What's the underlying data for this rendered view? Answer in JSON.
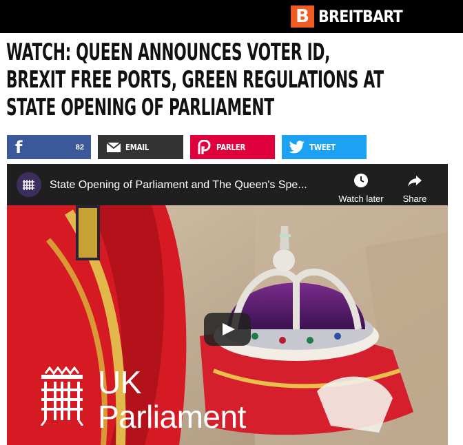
{
  "header": {
    "brand_mark": "B",
    "brand_name": "BREITBART"
  },
  "article": {
    "headline_lines": [
      "WATCH: QUEEN ANNOUNCES VOTER ID,",
      "BREXIT FREE PORTS, GREEN REGULATIONS AT",
      "STATE OPENING OF PARLIAMENT"
    ]
  },
  "share": {
    "facebook_count": "82",
    "email_label": "EMAIL",
    "parler_label": "PARLER",
    "tweet_label": "TWEET"
  },
  "video": {
    "title": "State Opening of Parliament and The Queen's Spe...",
    "watch_later_label": "Watch later",
    "share_label": "Share",
    "overlay_line1": "UK",
    "overlay_line2": "Parliament"
  },
  "colors": {
    "brand_orange": "#f15a22",
    "facebook": "#3b5998",
    "email": "#333333",
    "parler": "#e0003c",
    "twitter": "#1da1f2"
  }
}
